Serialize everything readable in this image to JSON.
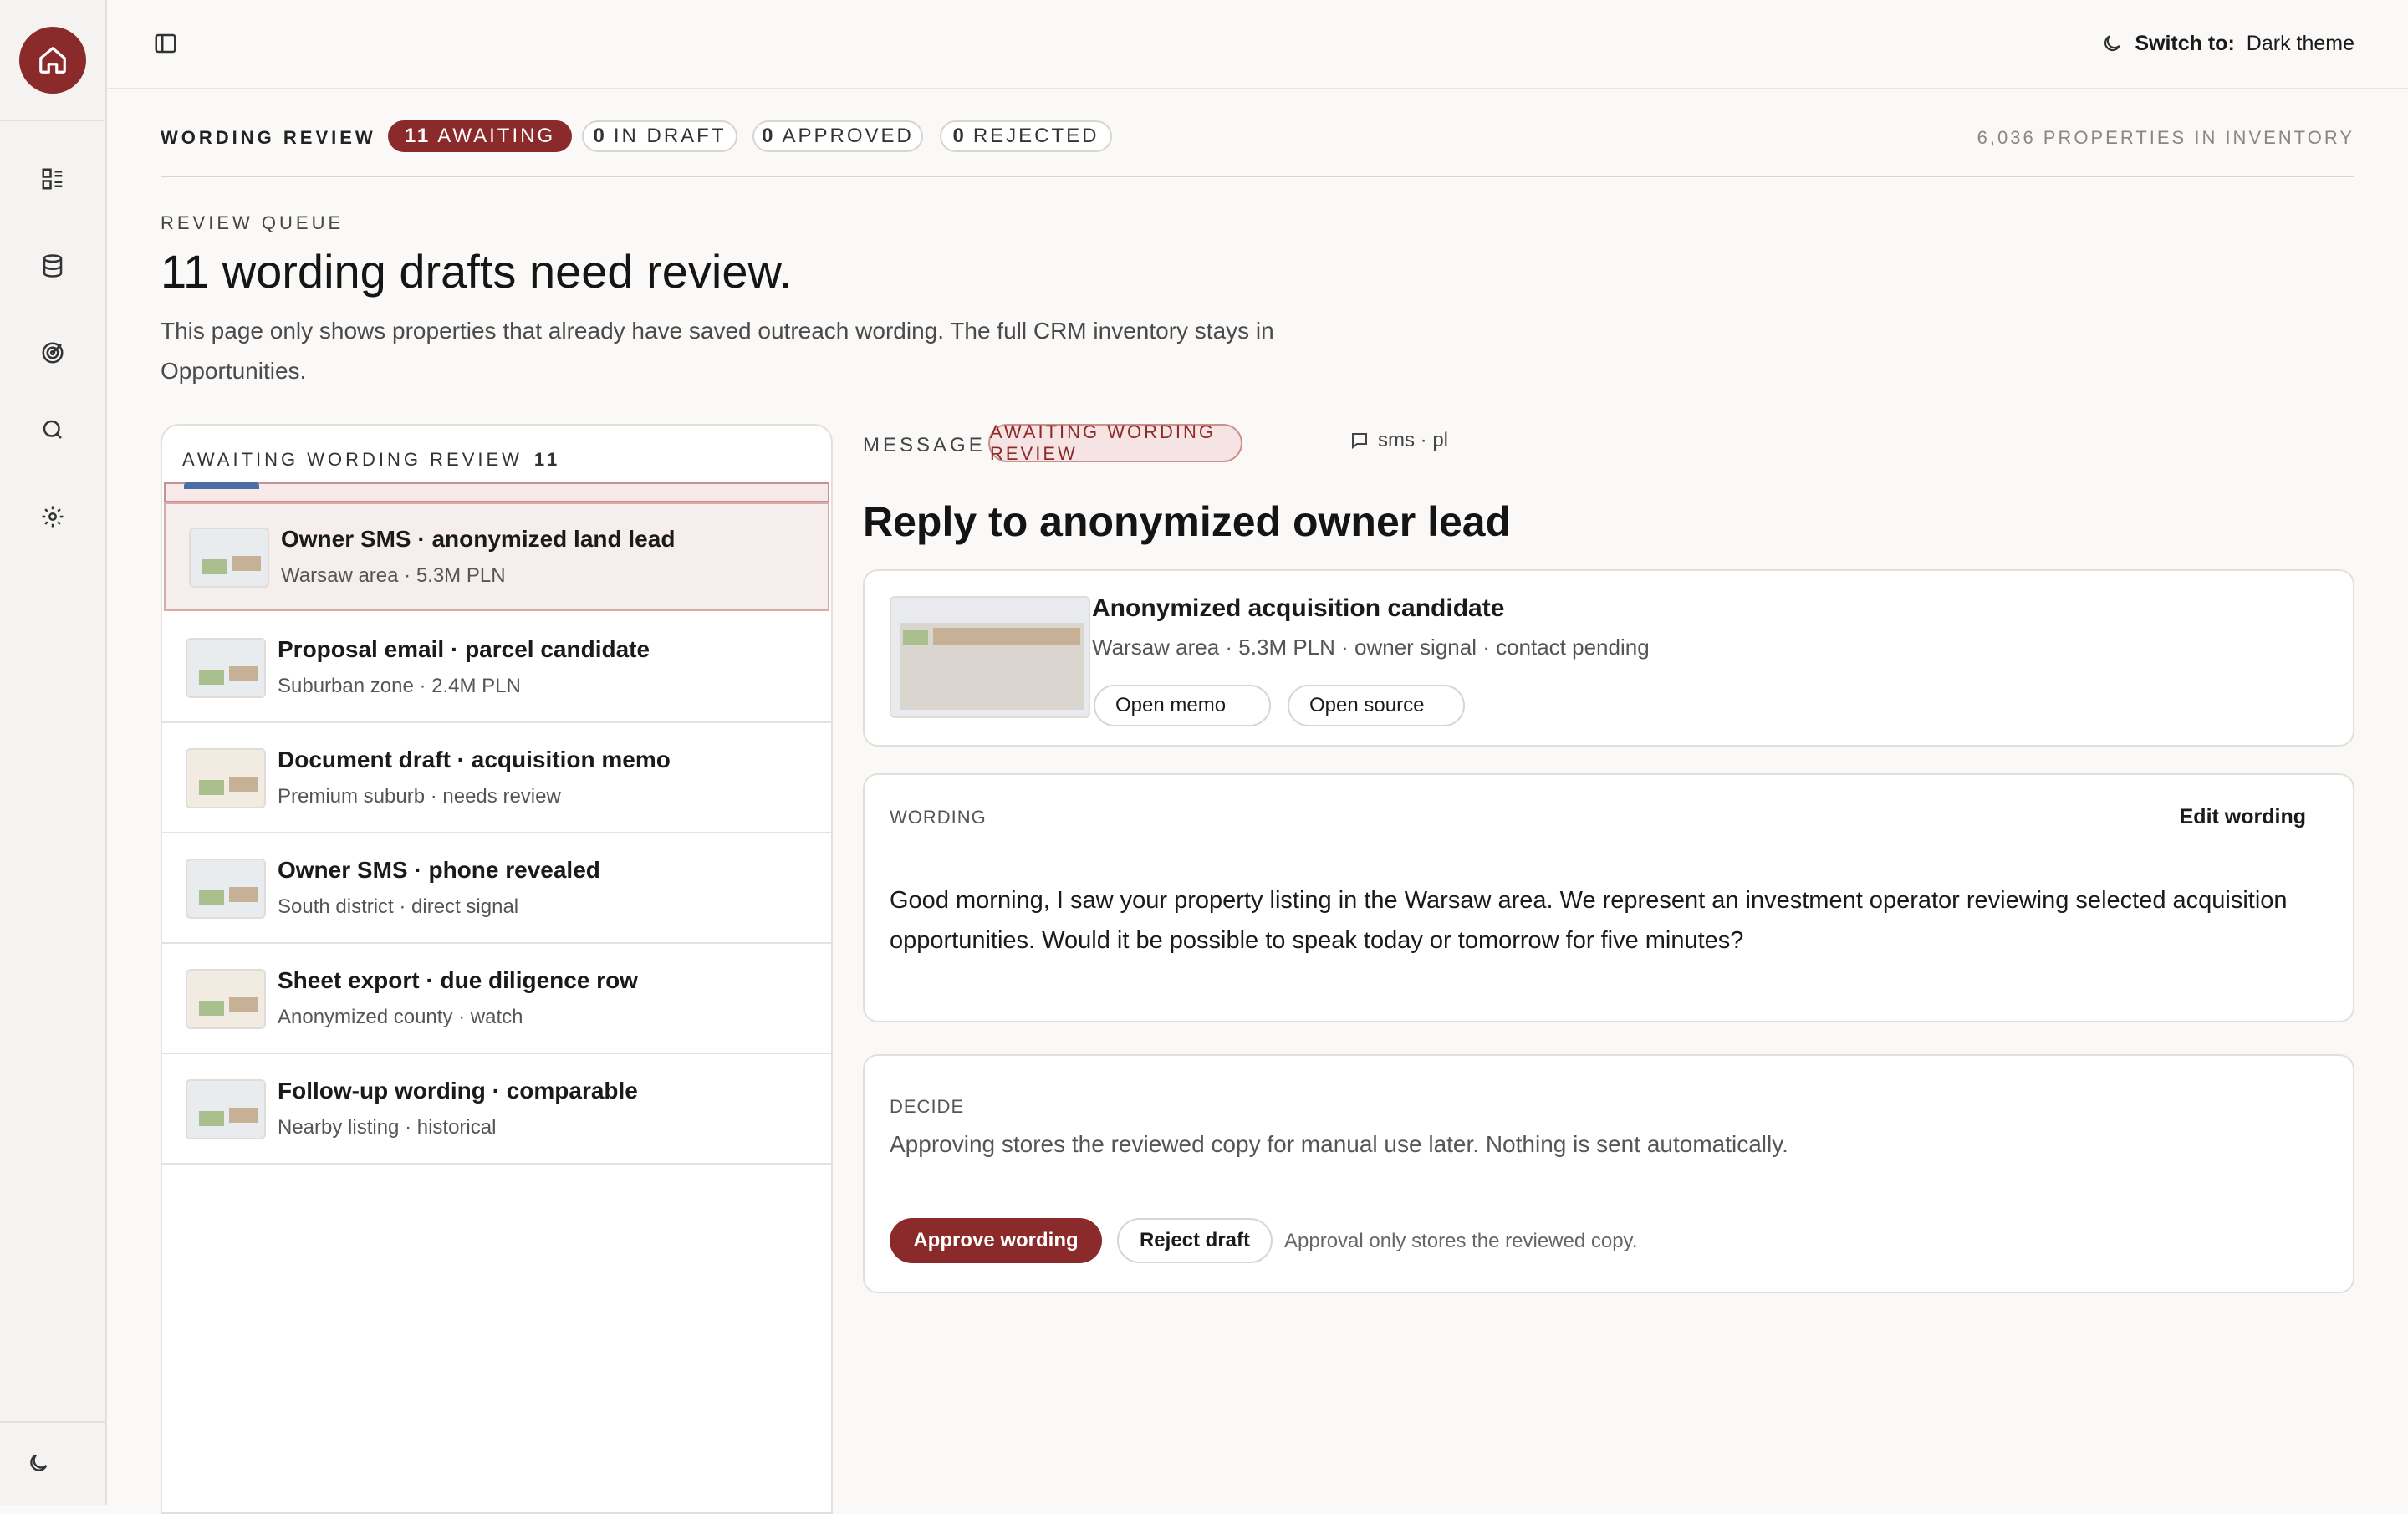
{
  "topbar": {
    "theme_prefix": "Switch to:",
    "theme_value": "Dark theme"
  },
  "status": {
    "title": "WORDING REVIEW",
    "pills": [
      {
        "count": "11",
        "label": "AWAITING"
      },
      {
        "count": "0",
        "label": "IN DRAFT"
      },
      {
        "count": "0",
        "label": "APPROVED"
      },
      {
        "count": "0",
        "label": "REJECTED"
      }
    ],
    "inventory": "6,036 PROPERTIES IN INVENTORY"
  },
  "page": {
    "eyebrow": "REVIEW QUEUE",
    "headline": "11 wording drafts need review.",
    "description": "This page only shows properties that already have saved outreach wording. The full CRM inventory stays in Opportunities."
  },
  "list": {
    "heading": "AWAITING WORDING REVIEW",
    "count": "11",
    "items": [
      {
        "title": "Owner SMS · anonymized land lead",
        "subtitle": "Warsaw area · 5.3M PLN"
      },
      {
        "title": "Proposal email · parcel candidate",
        "subtitle": "Suburban zone · 2.4M PLN"
      },
      {
        "title": "Document draft · acquisition memo",
        "subtitle": "Premium suburb · needs review"
      },
      {
        "title": "Owner SMS · phone revealed",
        "subtitle": "South district · direct signal"
      },
      {
        "title": "Sheet export · due diligence row",
        "subtitle": "Anonymized county · watch"
      },
      {
        "title": "Follow-up wording · comparable",
        "subtitle": "Nearby listing · historical"
      }
    ]
  },
  "detail": {
    "label": "MESSAGE",
    "status": "AWAITING WORDING REVIEW",
    "channel": "sms · pl",
    "title": "Reply to anonymized owner lead",
    "property": {
      "name": "Anonymized acquisition candidate",
      "meta": "Warsaw area · 5.3M PLN · owner signal · contact pending",
      "open_memo": "Open memo",
      "open_source": "Open source"
    },
    "wording": {
      "label": "WORDING",
      "edit": "Edit wording",
      "text": "Good morning, I saw your property listing in the Warsaw area. We represent an investment operator reviewing selected acquisition opportunities. Would it be possible to speak today or tomorrow for five minutes?"
    },
    "decide": {
      "label": "DECIDE",
      "text": "Approving stores the reviewed copy for manual use later. Nothing is sent automatically.",
      "approve": "Approve wording",
      "reject": "Reject draft",
      "note": "Approval only stores the reviewed copy."
    }
  },
  "colors": {
    "accent": "#8b2a2a",
    "selected_bg": "#f6eeec",
    "chip_bg": "#f5e4e3"
  }
}
